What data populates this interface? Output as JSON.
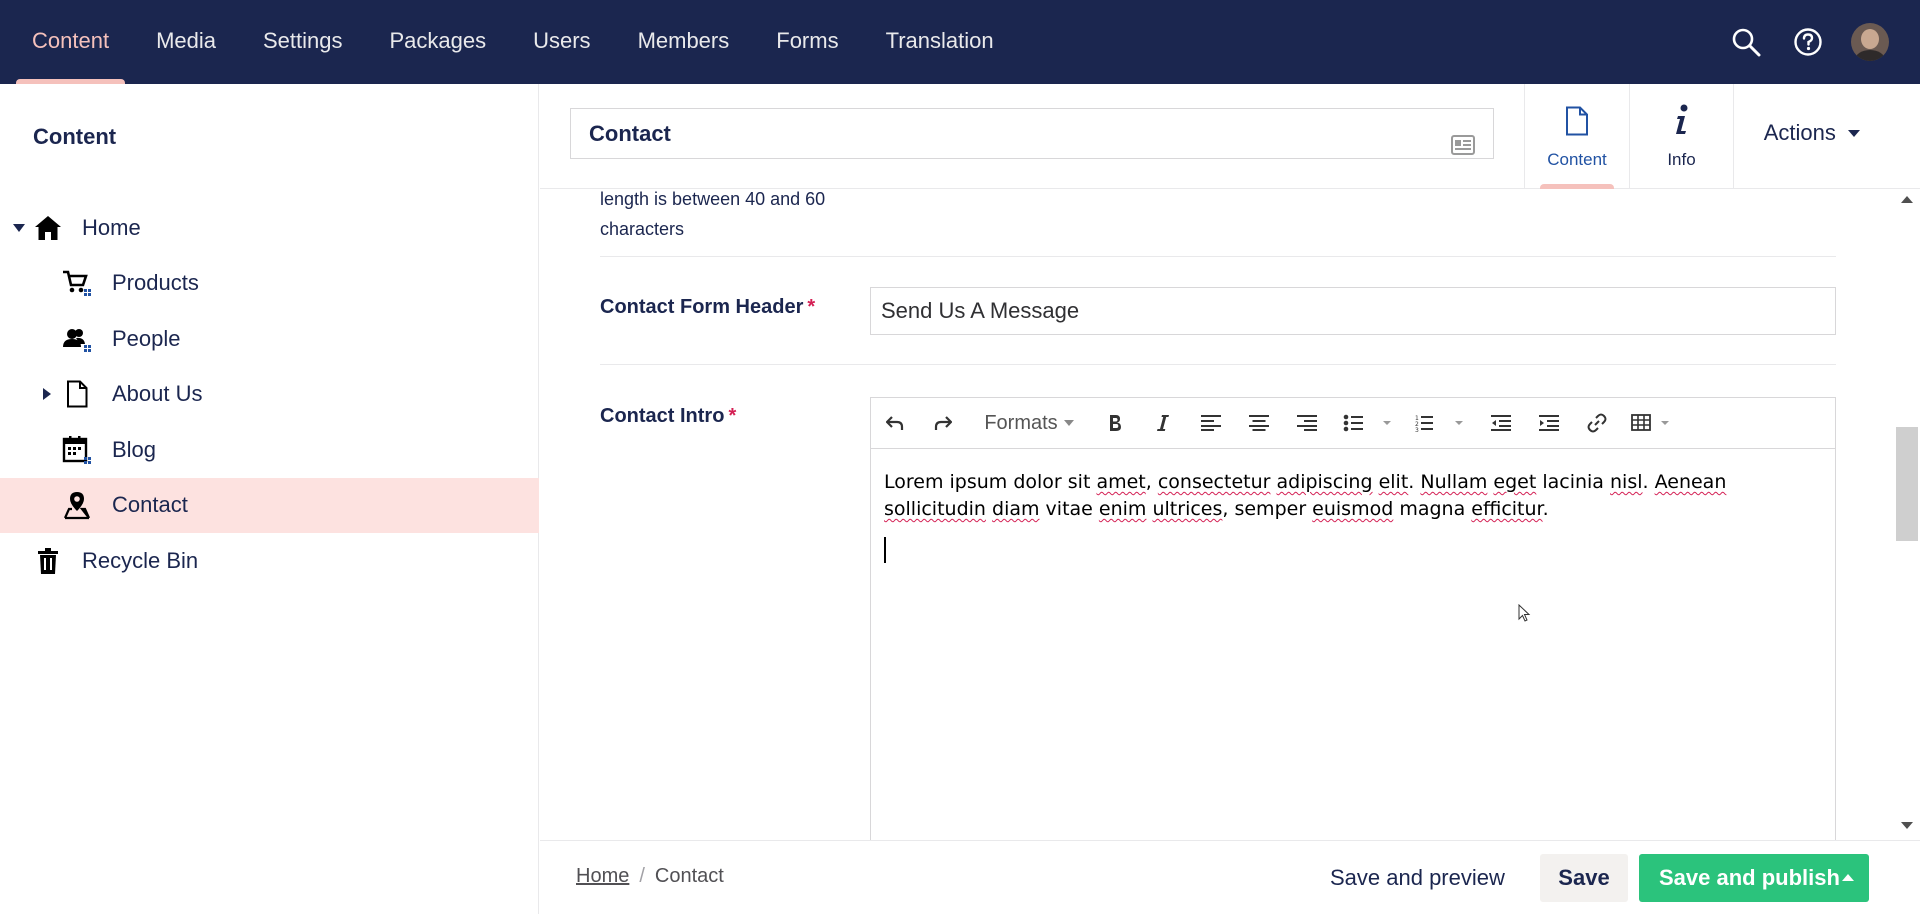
{
  "topnav": {
    "items": [
      "Content",
      "Media",
      "Settings",
      "Packages",
      "Users",
      "Members",
      "Forms",
      "Translation"
    ],
    "active": "Content",
    "icons": [
      "search-icon",
      "help-icon",
      "user-avatar"
    ]
  },
  "sidebar": {
    "title": "Content",
    "tree": [
      {
        "label": "Home",
        "icon": "home-icon",
        "expanded": true
      },
      {
        "label": "Products",
        "icon": "cart-icon"
      },
      {
        "label": "People",
        "icon": "users-icon"
      },
      {
        "label": "About Us",
        "icon": "document-icon",
        "collapsed": true
      },
      {
        "label": "Blog",
        "icon": "calendar-icon"
      },
      {
        "label": "Contact",
        "icon": "map-pin-icon",
        "selected": true
      },
      {
        "label": "Recycle Bin",
        "icon": "trash-icon"
      }
    ]
  },
  "editor": {
    "name": "Contact",
    "tabs": [
      {
        "label": "Content",
        "active": true
      },
      {
        "label": "Info"
      }
    ],
    "actions_label": "Actions"
  },
  "fields": {
    "prev_description": "length is between 40 and 60 characters",
    "form_header": {
      "label": "Contact Form Header",
      "required": "*",
      "value": "Send Us A Message"
    },
    "intro": {
      "label": "Contact Intro",
      "required": "*",
      "toolbar_formats": "Formats",
      "body_words": [
        "Lorem ipsum dolor sit ",
        "amet",
        ", ",
        "consectetur",
        " ",
        "adipiscing",
        " ",
        "elit",
        ". ",
        "Nullam",
        " ",
        "eget",
        " lacinia ",
        "nisl",
        ". ",
        "Aenean",
        " ",
        "sollicitudin",
        " ",
        "diam",
        " vitae ",
        "enim",
        " ",
        "ultrices",
        ", semper ",
        "euismod",
        " magna ",
        "efficitur",
        "."
      ]
    }
  },
  "footer": {
    "breadcrumb": [
      "Home",
      "Contact"
    ],
    "save_preview": "Save and preview",
    "save": "Save",
    "save_publish": "Save and publish"
  },
  "colors": {
    "nav_bg": "#1b264f",
    "accent_pink": "#f5c1bc",
    "selected_bg": "#fde2e0",
    "publish_green": "#2bc37c",
    "required_red": "#d42054"
  }
}
